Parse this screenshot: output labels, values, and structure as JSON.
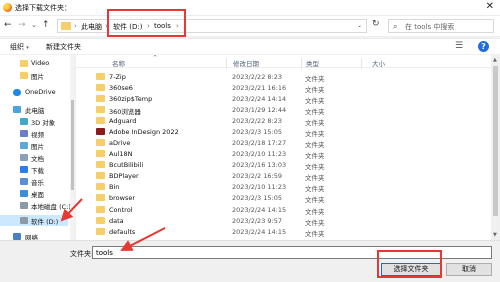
{
  "window": {
    "title": "选择下载文件夹：",
    "close_glyph": "✕"
  },
  "nav": {
    "back": "←",
    "forward": "→",
    "dropdown": "⌄",
    "up": "↑"
  },
  "address": {
    "segments": [
      "此电脑",
      "软件 (D:)",
      "tools"
    ],
    "separator": "›",
    "dropdown": "⌄",
    "refresh": "↻"
  },
  "search": {
    "placeholder": "在 tools 中搜索",
    "icon": "⌕"
  },
  "toolbar": {
    "organize": "组织",
    "new_folder": "新建文件夹",
    "dropdown": "▾",
    "view_icon": "☰",
    "help": "?"
  },
  "sidebar": {
    "items": [
      {
        "label": "Video",
        "icon": "folder-icon"
      },
      {
        "label": "图片",
        "icon": "folder-icon"
      },
      {
        "label": "OneDrive",
        "icon": "cloud-icon"
      },
      {
        "label": "此电脑",
        "icon": "computer-icon"
      },
      {
        "label": "3D 对象",
        "icon": "cube-icon"
      },
      {
        "label": "视频",
        "icon": "video-icon"
      },
      {
        "label": "图片",
        "icon": "picture-icon"
      },
      {
        "label": "文档",
        "icon": "document-icon"
      },
      {
        "label": "下载",
        "icon": "download-icon"
      },
      {
        "label": "音乐",
        "icon": "music-icon"
      },
      {
        "label": "桌面",
        "icon": "desktop-icon"
      },
      {
        "label": "本地磁盘 (C:)",
        "icon": "drive-icon"
      },
      {
        "label": "软件 (D:)",
        "icon": "drive-icon",
        "selected": true
      },
      {
        "label": "网络",
        "icon": "network-icon"
      }
    ]
  },
  "columns": {
    "name": "名称",
    "date": "修改日期",
    "type": "类型",
    "size": "大小",
    "sort_glyph": "^"
  },
  "files": [
    {
      "name": "7-Zip",
      "date": "2023/2/22 8:23",
      "type": "文件夹"
    },
    {
      "name": "360se6",
      "date": "2023/2/21 16:16",
      "type": "文件夹"
    },
    {
      "name": "360zip$Temp",
      "date": "2023/2/24 14:14",
      "type": "文件夹"
    },
    {
      "name": "360浏览器",
      "date": "2023/1/29 12:44",
      "type": "文件夹"
    },
    {
      "name": "Adguard",
      "date": "2023/2/22 8:23",
      "type": "文件夹"
    },
    {
      "name": "Adobe InDesign 2022",
      "date": "2023/2/3 15:05",
      "type": "文件夹"
    },
    {
      "name": "aDrive",
      "date": "2023/2/18 17:27",
      "type": "文件夹"
    },
    {
      "name": "Aul18N",
      "date": "2023/2/10 11:23",
      "type": "文件夹"
    },
    {
      "name": "BcutBilibili",
      "date": "2023/2/16 13:03",
      "type": "文件夹"
    },
    {
      "name": "BDPlayer",
      "date": "2023/2/2 16:59",
      "type": "文件夹"
    },
    {
      "name": "Bin",
      "date": "2023/2/10 11:23",
      "type": "文件夹"
    },
    {
      "name": "browser",
      "date": "2023/2/3 15:05",
      "type": "文件夹"
    },
    {
      "name": "Control",
      "date": "2023/2/24 14:15",
      "type": "文件夹"
    },
    {
      "name": "data",
      "date": "2023/2/23 9:57",
      "type": "文件夹"
    },
    {
      "name": "defaults",
      "date": "2023/2/24 14:15",
      "type": "文件夹"
    }
  ],
  "footer": {
    "filename_label": "文件夹:",
    "filename_value": "tools",
    "select_button": "选择文件夹",
    "cancel_button": "取消"
  },
  "annotation_color": "#e53935"
}
